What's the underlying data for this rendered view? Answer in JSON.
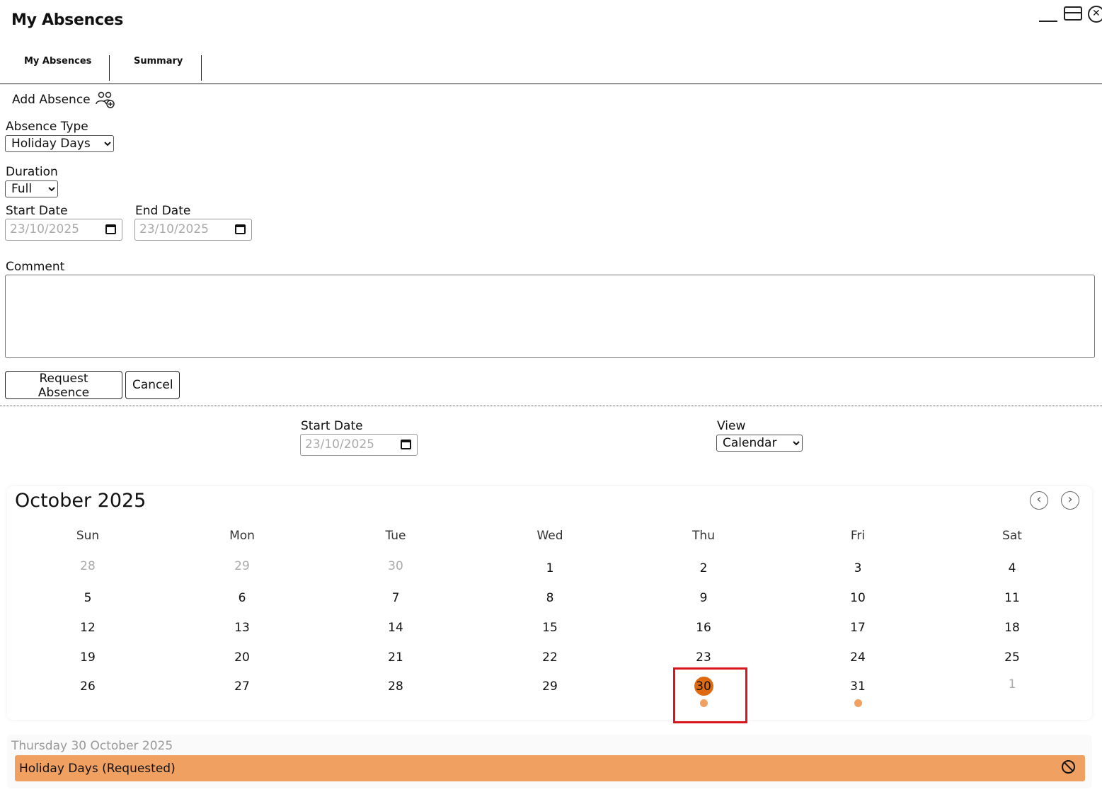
{
  "window": {
    "title": "My Absences"
  },
  "tabs": [
    {
      "label": "My Absences"
    },
    {
      "label": "Summary"
    }
  ],
  "add_absence": {
    "label": "Add Absence",
    "icon": "add-people-icon"
  },
  "form": {
    "absence_type_label": "Absence Type",
    "absence_type_value": "Holiday Days",
    "duration_label": "Duration",
    "duration_value": "Full",
    "start_date_label": "Start Date",
    "start_date_value": "23/10/2025",
    "end_date_label": "End Date",
    "end_date_value": "23/10/2025",
    "comment_label": "Comment",
    "comment_value": "",
    "request_button": "Request Absence",
    "cancel_button": "Cancel"
  },
  "filters": {
    "start_date_label": "Start Date",
    "start_date_value": "23/10/2025",
    "view_label": "View",
    "view_value": "Calendar"
  },
  "calendar": {
    "month_title": "October 2025",
    "weekdays": [
      "Sun",
      "Mon",
      "Tue",
      "Wed",
      "Thu",
      "Fri",
      "Sat"
    ],
    "weeks": [
      [
        "28",
        "29",
        "30",
        "1",
        "2",
        "3",
        "4"
      ],
      [
        "5",
        "6",
        "7",
        "8",
        "9",
        "10",
        "11"
      ],
      [
        "12",
        "13",
        "14",
        "15",
        "16",
        "17",
        "18"
      ],
      [
        "19",
        "20",
        "21",
        "22",
        "23",
        "24",
        "25"
      ],
      [
        "26",
        "27",
        "28",
        "29",
        "30",
        "31",
        "1"
      ]
    ],
    "selected_day": "30",
    "accent_color": "#e06a10",
    "event_dot_color": "#f0a060"
  },
  "event_panel": {
    "date_heading": "Thursday 30 October 2025",
    "event_label": "Holiday Days (Requested)",
    "event_color": "#f0a060",
    "action_icon": "cancel-circle-icon"
  }
}
